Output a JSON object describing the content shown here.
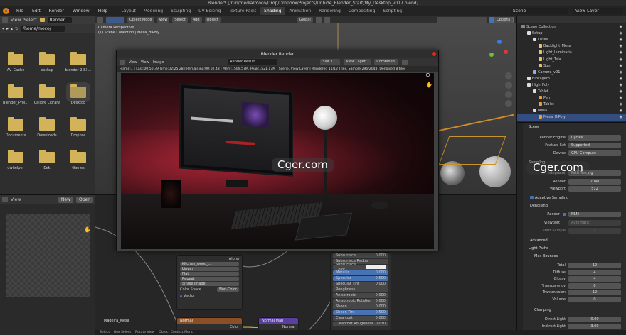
{
  "window": {
    "title": "Blender* [/run/media/moco/Drop/Dropbox/Projects/Unhide_Blender_Start/My_Desktop_v017.blend]"
  },
  "menu": {
    "items": [
      "File",
      "Edit",
      "Render",
      "Window",
      "Help"
    ],
    "workspaces": [
      "Layout",
      "Modeling",
      "Sculpting",
      "UV Editing",
      "Texture Paint",
      "Shading",
      "Animation",
      "Rendering",
      "Compositing",
      "Scripting"
    ],
    "active_workspace": "Shading",
    "scene": "Scene",
    "view_layer": "View Layer"
  },
  "filebrowser": {
    "view_label": "View",
    "select_label": "Select",
    "render_label": "Render",
    "path": "/home/moco/",
    "folders": [
      "AV_Cache",
      "backup",
      "blender 2.83...",
      "Blender_Proj...",
      "Calibre Library",
      "Desktop",
      "Documents",
      "Downloads",
      "Dropbox",
      "dwhelper",
      "Eek",
      "Games"
    ]
  },
  "imgeditor": {
    "view_label": "View",
    "new_label": "New",
    "open_label": "Open"
  },
  "viewport": {
    "mode": "Object Mode",
    "view": "View",
    "select": "Select",
    "add": "Add",
    "object": "Object",
    "info1": "Camera Perspective",
    "info2": "(1) Scene Collection | Mesa_HiPoly",
    "orientation": "Global",
    "options": "Options"
  },
  "render_window": {
    "title": "Blender Render",
    "view": "View",
    "view2": "View",
    "image": "Image",
    "render_result": "Render Result",
    "slot": "Slot 1",
    "view_layer": "View Layer",
    "combined": "Combined",
    "info": "Frame:1 | Last:00:50.39 Time:02:25.28 | Remaining:00:10.48 | Mem:1509.57M, Peak:1521.17M | Scene, View Layer | Rendered 11/12 Tiles, Sample 296/2048, Denoised 8 tiles"
  },
  "outliner": {
    "header": "Scene Collection",
    "rows": [
      {
        "label": "Scene Collection",
        "level": 0
      },
      {
        "label": "Setup",
        "level": 1
      },
      {
        "label": "Luzes",
        "level": 2
      },
      {
        "label": "Backlight_Mesa",
        "level": 3
      },
      {
        "label": "Light_Luminaria",
        "level": 3
      },
      {
        "label": "Light_Tela",
        "level": 3
      },
      {
        "label": "Sun",
        "level": 3
      },
      {
        "label": "Camera_v01",
        "level": 2
      },
      {
        "label": "Blocagem",
        "level": 1
      },
      {
        "label": "High_Poly",
        "level": 1
      },
      {
        "label": "Tablet",
        "level": 2
      },
      {
        "label": "Pen",
        "level": 3
      },
      {
        "label": "Tablet",
        "level": 3
      },
      {
        "label": "Mesa",
        "level": 2
      },
      {
        "label": "Mesa_HiPoly",
        "level": 3
      }
    ],
    "selected": "Mesa_HiPoly"
  },
  "properties": {
    "scene_label": "Scene",
    "render_engine_label": "Render Engine",
    "render_engine": "Cycles",
    "feature_set_label": "Feature Set",
    "feature_set": "Supported",
    "device_label": "Device",
    "device": "GPU Compute",
    "sampling": "Sampling",
    "integrator_label": "Integrator",
    "integrator": "Path Tracing",
    "render_label": "Render",
    "render_samples": "2048",
    "viewport_label": "Viewport",
    "viewport_samples": "512",
    "adaptive": "Adaptive Sampling",
    "denoising": "Denoising",
    "denoise_render_label": "Render",
    "denoise_render": "NLM",
    "denoise_viewport_label": "Viewport",
    "denoise_viewport": "Automatic",
    "start_sample_label": "Start Sample",
    "start_sample": "1",
    "advanced": "Advanced",
    "light_paths": "Light Paths",
    "max_bounces": "Max Bounces",
    "bounces": [
      {
        "label": "Total",
        "value": "12"
      },
      {
        "label": "Diffuse",
        "value": "4"
      },
      {
        "label": "Glossy",
        "value": "4"
      },
      {
        "label": "Transparency",
        "value": "8"
      },
      {
        "label": "Transmission",
        "value": "12"
      },
      {
        "label": "Volume",
        "value": "0"
      }
    ],
    "clamping": "Clamping",
    "direct_light_label": "Direct Light",
    "direct_light": "0.00",
    "indirect_light_label": "Indirect Light",
    "indirect_light": "3.00"
  },
  "nodes": {
    "image_tex_file": "kitchen_wood_...",
    "interp": "Linear",
    "proj": "Flat",
    "ext": "Repeat",
    "src": "Single Image",
    "colorspace_label": "Color Space",
    "colorspace": "Non-Color",
    "vector": "Vector",
    "alpha": "Alpha",
    "color": "Color",
    "normal_node": "Normal",
    "normal_map": "Normal Map",
    "material": "Madeira_Mesa",
    "bsdf": [
      {
        "label": "Subsurface",
        "value": "0.000"
      },
      {
        "label": "Subsurface Radius",
        "value": ""
      },
      {
        "label": "Subsurface Color",
        "value": ""
      },
      {
        "label": "Metallic",
        "value": "0.000"
      },
      {
        "label": "Specular",
        "value": "0.500"
      },
      {
        "label": "Specular Tint",
        "value": "0.000"
      },
      {
        "label": "Roughness",
        "value": ""
      },
      {
        "label": "Anisotropic",
        "value": "0.000"
      },
      {
        "label": "Anisotropic Rotation",
        "value": "0.000"
      },
      {
        "label": "Sheen",
        "value": "0.000"
      },
      {
        "label": "Sheen Tint",
        "value": "0.500"
      },
      {
        "label": "Clearcoat",
        "value": "0.000"
      },
      {
        "label": "Clearcoat Roughness",
        "value": "0.030"
      }
    ]
  },
  "watermark": "Cger.com",
  "status": {
    "items": [
      "Select",
      "Box Select",
      "Rotate View",
      "Object Context Menu"
    ]
  },
  "colors": {
    "accent": "#4772b3",
    "selection": "#334d80",
    "folder": "#d2b35a",
    "close": "#e0261b",
    "logo": "#e87d0d"
  }
}
